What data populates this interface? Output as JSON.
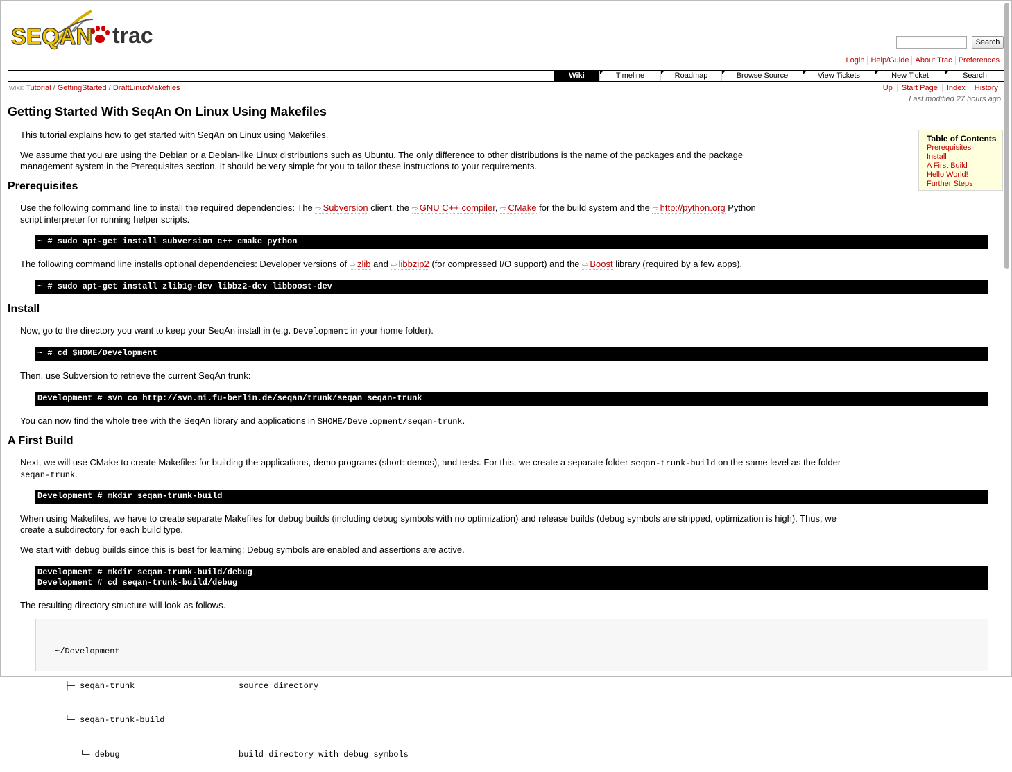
{
  "header": {
    "logo": {
      "seqan_text": "SEQAN",
      "trac_text": "trac"
    },
    "search_button": "Search",
    "metanav": [
      "Login",
      "Help/Guide",
      "About Trac",
      "Preferences"
    ]
  },
  "mainnav": {
    "tabs": [
      {
        "label": "Wiki",
        "active": true
      },
      {
        "label": "Timeline",
        "active": false
      },
      {
        "label": "Roadmap",
        "active": false
      },
      {
        "label": "Browse Source",
        "active": false
      },
      {
        "label": "View Tickets",
        "active": false
      },
      {
        "label": "New Ticket",
        "active": false
      },
      {
        "label": "Search",
        "active": false
      }
    ]
  },
  "breadcrumb": {
    "prefix": "wiki:",
    "items": [
      "Tutorial",
      "GettingStarted",
      "DraftLinuxMakefiles"
    ],
    "separator": "/"
  },
  "ctxtnav": [
    "Up",
    "Start Page",
    "Index",
    "History"
  ],
  "last_modified": "Last modified 27 hours ago",
  "page": {
    "title": "Getting Started With SeqAn On Linux Using Makefiles",
    "intro1": "This tutorial explains how to get started with SeqAn on Linux using Makefiles.",
    "intro2_line1": "We assume that you are using the Debian or a Debian-like Linux distributions such as Ubuntu. The only difference to other distributions is the name of the packages and the package",
    "intro2_line2": "management system in the Prerequisites section. It should be very simple for you to tailor these instructions to your requirements.",
    "h_prereq": "Prerequisites",
    "prereq_p1": {
      "t1": "Use the following command line to install the required dependencies: The ",
      "link_subversion": "Subversion",
      "t2": " client, the ",
      "link_gcc": "GNU C++ compiler",
      "t3": ", ",
      "link_cmake": "CMake",
      "t4": " for the build system and the ",
      "link_python": "http://python.org",
      "t5": " Python",
      "line2": "script interpreter for running helper scripts."
    },
    "cmd1": "~ # sudo apt-get install subversion c++ cmake python",
    "prereq_p2": {
      "t1": "The following command line installs optional dependencies: Developer versions of ",
      "link_zlib": "zlib",
      "t2": " and ",
      "link_libbzip2": "libbzip2",
      "t3": " (for compressed I/O support) and the ",
      "link_boost": "Boost",
      "t4": " library (required by a few apps)."
    },
    "cmd2": "~ # sudo apt-get install zlib1g-dev libbz2-dev libboost-dev",
    "h_install": "Install",
    "install_p1": {
      "t1": "Now, go to the directory you want to keep your SeqAn install in (e.g. ",
      "code": "Development",
      "t2": " in your home folder)."
    },
    "cmd3": "~ # cd $HOME/Development",
    "install_p2": "Then, use Subversion to retrieve the current SeqAn trunk:",
    "cmd4": "Development # svn co http://svn.mi.fu-berlin.de/seqan/trunk/seqan seqan-trunk",
    "install_p3": {
      "t1": "You can now find the whole tree with the SeqAn library and applications in ",
      "code": "$HOME/Development/seqan-trunk",
      "t2": "."
    },
    "h_build": "A First Build",
    "build_p1": {
      "t1": "Next, we will use CMake to create Makefiles for building the applications, demo programs (short: demos), and tests. For this, we create a separate folder ",
      "code1": "seqan-trunk-build",
      "t2": " on the same level as the folder",
      "code2": "seqan-trunk",
      "t3": "."
    },
    "cmd5": "Development # mkdir seqan-trunk-build",
    "build_p2_line1": "When using Makefiles, we have to create separate Makefiles for debug builds (including debug symbols with no optimization) and release builds (debug symbols are stripped, optimization is high). Thus, we",
    "build_p2_line2": "create a subdirectory for each build type.",
    "build_p3": "We start with debug builds since this is best for learning: Debug symbols are enabled and assertions are active.",
    "cmd6_line1": "Development # mkdir seqan-trunk-build/debug",
    "cmd6_line2": "Development # cd seqan-trunk-build/debug",
    "build_p4": "The resulting directory structure will look as follows.",
    "tree": [
      {
        "name": "~/Development",
        "desc": ""
      },
      {
        "name": "  ├─ seqan-trunk",
        "desc": "source directory"
      },
      {
        "name": "  └─ seqan-trunk-build",
        "desc": ""
      },
      {
        "name": "     └─ debug",
        "desc": "build directory with debug symbols"
      }
    ]
  },
  "toc": {
    "title": "Table of Contents",
    "items": [
      "Prerequisites",
      "Install",
      "A First Build",
      "Hello World!",
      "Further Steps"
    ]
  },
  "colors": {
    "link": "#bb0000",
    "toc_bg": "#ffffdd",
    "pre_bg": "#000000"
  }
}
